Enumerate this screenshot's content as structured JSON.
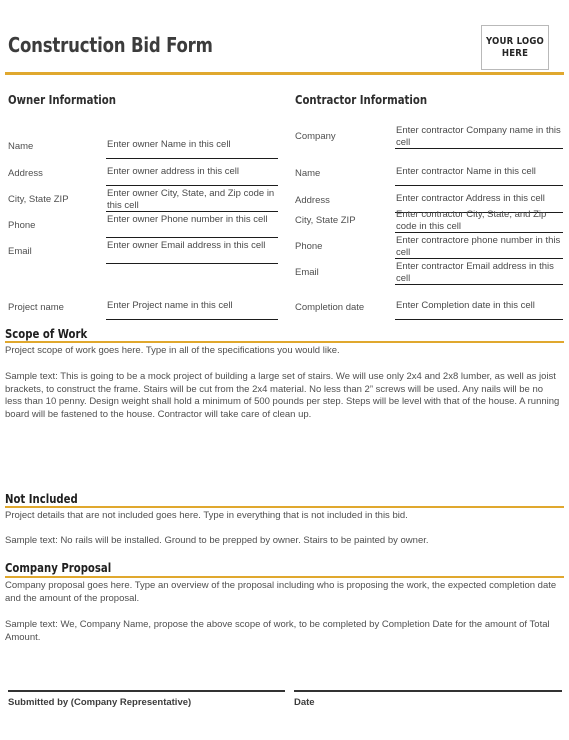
{
  "header": {
    "title": "Construction Bid Form",
    "logo_line1": "YOUR LOGO",
    "logo_line2": "HERE"
  },
  "owner": {
    "heading": "Owner Information",
    "fields": [
      {
        "label": "Name",
        "value": "Enter owner Name in this cell"
      },
      {
        "label": "Address",
        "value": "Enter owner address in this cell"
      },
      {
        "label": "City, State ZIP",
        "value": "Enter owner City, State, and Zip code in this cell"
      },
      {
        "label": "Phone",
        "value": "Enter owner Phone number in this cell"
      },
      {
        "label": "Email",
        "value": "Enter owner Email address in this cell"
      }
    ],
    "project": {
      "label": "Project name",
      "value": "Enter Project name in this cell"
    }
  },
  "contractor": {
    "heading": "Contractor Information",
    "fields": [
      {
        "label": "Company",
        "value": "Enter contractor Company name in this cell"
      },
      {
        "label": "Name",
        "value": "Enter contractor Name in this cell"
      },
      {
        "label": "Address",
        "value": "Enter contractor Address in this cell"
      },
      {
        "label": "City, State ZIP",
        "value": "Enter contractor City, State, and Zip code in this cell"
      },
      {
        "label": "Phone",
        "value": "Enter contractore phone number in this cell"
      },
      {
        "label": "Email",
        "value": "Enter contractor Email address in this cell"
      }
    ],
    "completion": {
      "label": "Completion date",
      "value": "Enter Completion date in this cell"
    }
  },
  "scope": {
    "heading": "Scope of Work",
    "intro": "Project scope of work goes here. Type in all of the specifications you would like.",
    "sample": "Sample text: This is going to be a mock project of building a large set of stairs. We will use only 2x4 and 2x8 lumber, as well as joist brackets, to construct the frame. Stairs will be cut from the 2x4 material. No less than 2” screws will be used.  Any nails will be no less than 10 penny. Design weight shall hold a minimum of 500 pounds per step. Steps will be level with that of the house. A running board will be fastened to the house. Contractor will take care of clean up."
  },
  "not_included": {
    "heading": "Not Included",
    "intro": "Project details that are not included goes here. Type in everything that is not included in this bid.",
    "sample": "Sample text: No rails will be installed. Ground to be prepped by owner. Stairs to be painted by owner."
  },
  "proposal": {
    "heading": "Company Proposal",
    "intro": "Company proposal goes here. Type an overview of the proposal including who is proposing the work, the expected completion date and the amount of the proposal.",
    "sample": "Sample text: We, Company Name, propose the above scope of work, to be completed by Completion Date for the amount of Total Amount."
  },
  "footer": {
    "submitted_by_label": "Submitted by (Company Representative)",
    "date_label": "Date"
  },
  "colors": {
    "accent": "#e0a82e",
    "title": "#3c3c3c",
    "text": "#4f4f4f",
    "rule": "#1d1d1d"
  }
}
